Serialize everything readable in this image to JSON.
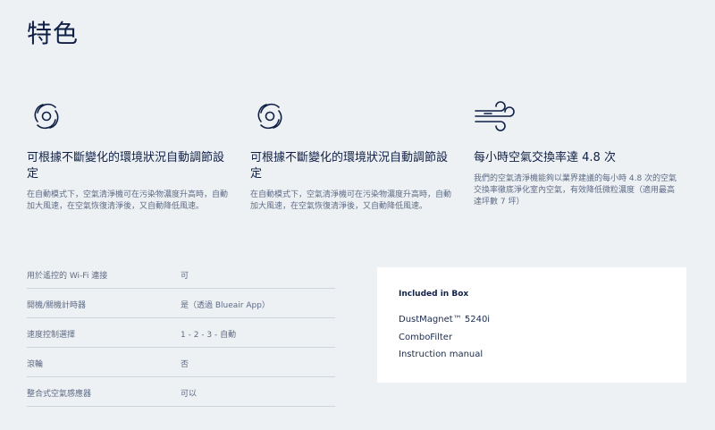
{
  "page": {
    "title": "特色"
  },
  "features": [
    {
      "icon": "auto-mode-swirl-icon",
      "title": "可根據不斷變化的環境狀況自動調節設定",
      "description": "在自動模式下，空氣清淨機可在污染物濃度升高時，自動加大風速，在空氣恢復清淨後，又自動降低風速。"
    },
    {
      "icon": "auto-mode-swirl-icon",
      "title": "可根據不斷變化的環境狀況自動調節設定",
      "description": "在自動模式下，空氣清淨機可在污染物濃度升高時，自動加大風速，在空氣恢復清淨後，又自動降低風速。"
    },
    {
      "icon": "wind-icon",
      "title": "每小時空氣交換率達 4.8 次",
      "description": "我們的空氣清淨機能夠以業界建議的每小時 4.8 次的空氣交換率徹底淨化室內空氣，有效降低微粒濃度（適用最高達坪數 7 坪）"
    }
  ],
  "specs": [
    {
      "label": "用於遙控的 Wi-Fi 連接",
      "value": "可"
    },
    {
      "label": "開機/關機計時器",
      "value": "是（透過 Blueair App）"
    },
    {
      "label": "速度控制選擇",
      "value": "1 - 2 - 3 - 自動"
    },
    {
      "label": "滾輪",
      "value": "否"
    },
    {
      "label": "整合式空氣感應器",
      "value": "可以"
    }
  ],
  "in_box": {
    "title": "Included in Box",
    "items": [
      "DustMagnet™ 5240i",
      "ComboFilter",
      "Instruction manual"
    ]
  },
  "colors": {
    "background": "#eef1f4",
    "icon": "#0f1f45",
    "text_primary": "#0f1f45",
    "text_secondary": "#5d6b85"
  }
}
